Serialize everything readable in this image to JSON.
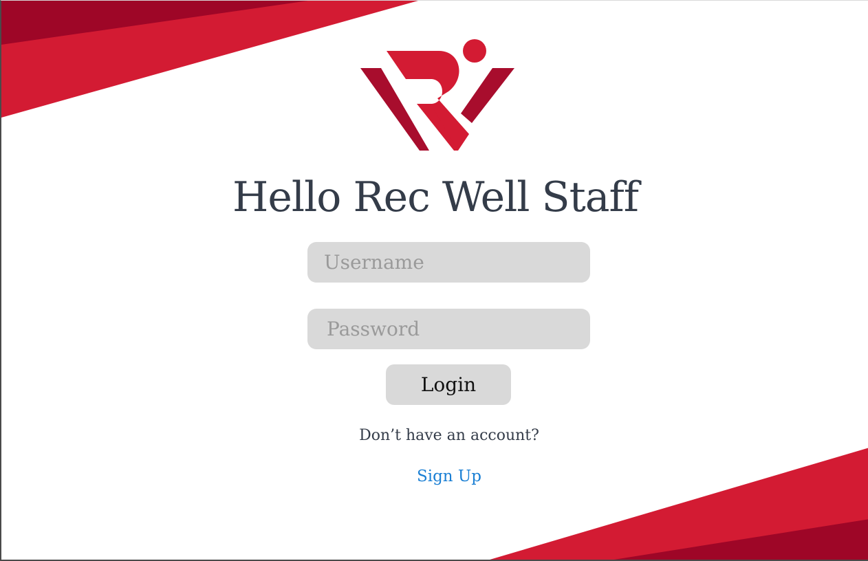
{
  "login": {
    "title": "Hello Rec Well Staff",
    "username_placeholder": "Username",
    "password_placeholder": "Password",
    "login_label": "Login",
    "no_account_text": "Don’t have an account?",
    "signup_label": "Sign Up"
  },
  "colors": {
    "brand_red": "#d31b33",
    "brand_dark_red": "#9e0627",
    "logo_dark": "#a80d2d",
    "input_bg": "#d9d9d9",
    "title_text": "#343c49",
    "link": "#1a7fd4"
  },
  "icons": {
    "logo": "rec-well-logo-icon"
  }
}
